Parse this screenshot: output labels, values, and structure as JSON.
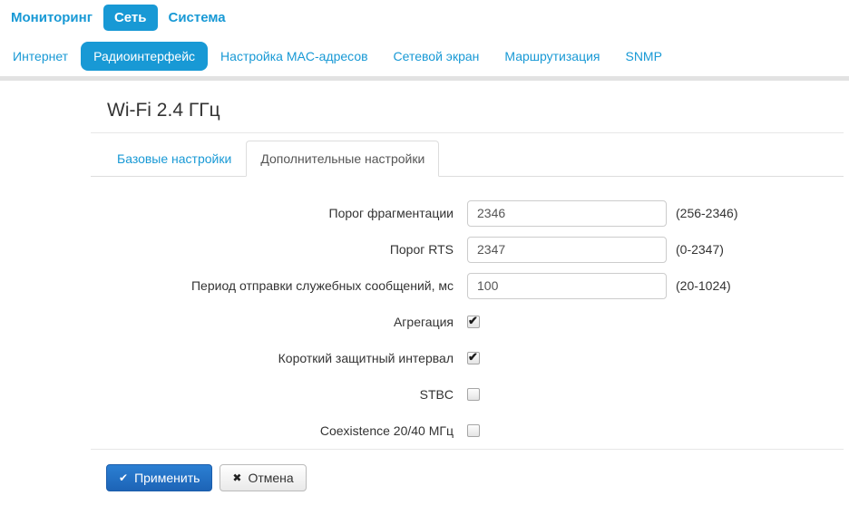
{
  "colors": {
    "accent": "#1899d5",
    "apply-top": "#2b7fd3",
    "apply-bottom": "#1d64b6",
    "apply-border": "#1b5dab"
  },
  "nav_primary": {
    "items": [
      {
        "label": "Мониторинг",
        "active": false
      },
      {
        "label": "Сеть",
        "active": true
      },
      {
        "label": "Система",
        "active": false
      }
    ]
  },
  "nav_secondary": {
    "items": [
      {
        "label": "Интернет",
        "active": false
      },
      {
        "label": "Радиоинтерфейс",
        "active": true
      },
      {
        "label": "Настройка MAC-адресов",
        "active": false
      },
      {
        "label": "Сетевой экран",
        "active": false
      },
      {
        "label": "Маршрутизация",
        "active": false
      },
      {
        "label": "SNMP",
        "active": false
      }
    ]
  },
  "page": {
    "title": "Wi-Fi 2.4 ГГц"
  },
  "tabs": [
    {
      "label": "Базовые настройки",
      "active": false
    },
    {
      "label": "Дополнительные настройки",
      "active": true
    }
  ],
  "form": {
    "fields": [
      {
        "type": "text",
        "label": "Порог фрагментации",
        "value": "2346",
        "hint": "(256-2346)"
      },
      {
        "type": "text",
        "label": "Порог RTS",
        "value": "2347",
        "hint": "(0-2347)"
      },
      {
        "type": "text",
        "label": "Период отправки служебных сообщений, мс",
        "value": "100",
        "hint": "(20-1024)"
      },
      {
        "type": "checkbox",
        "label": "Агрегация",
        "checked": true
      },
      {
        "type": "checkbox",
        "label": "Короткий защитный интервал",
        "checked": true
      },
      {
        "type": "checkbox",
        "label": "STBC",
        "checked": false
      },
      {
        "type": "checkbox",
        "label": "Coexistence 20/40 МГц",
        "checked": false
      }
    ]
  },
  "actions": {
    "apply_icon": "✔",
    "apply": "Применить",
    "cancel_icon": "✖",
    "cancel": "Отмена"
  }
}
